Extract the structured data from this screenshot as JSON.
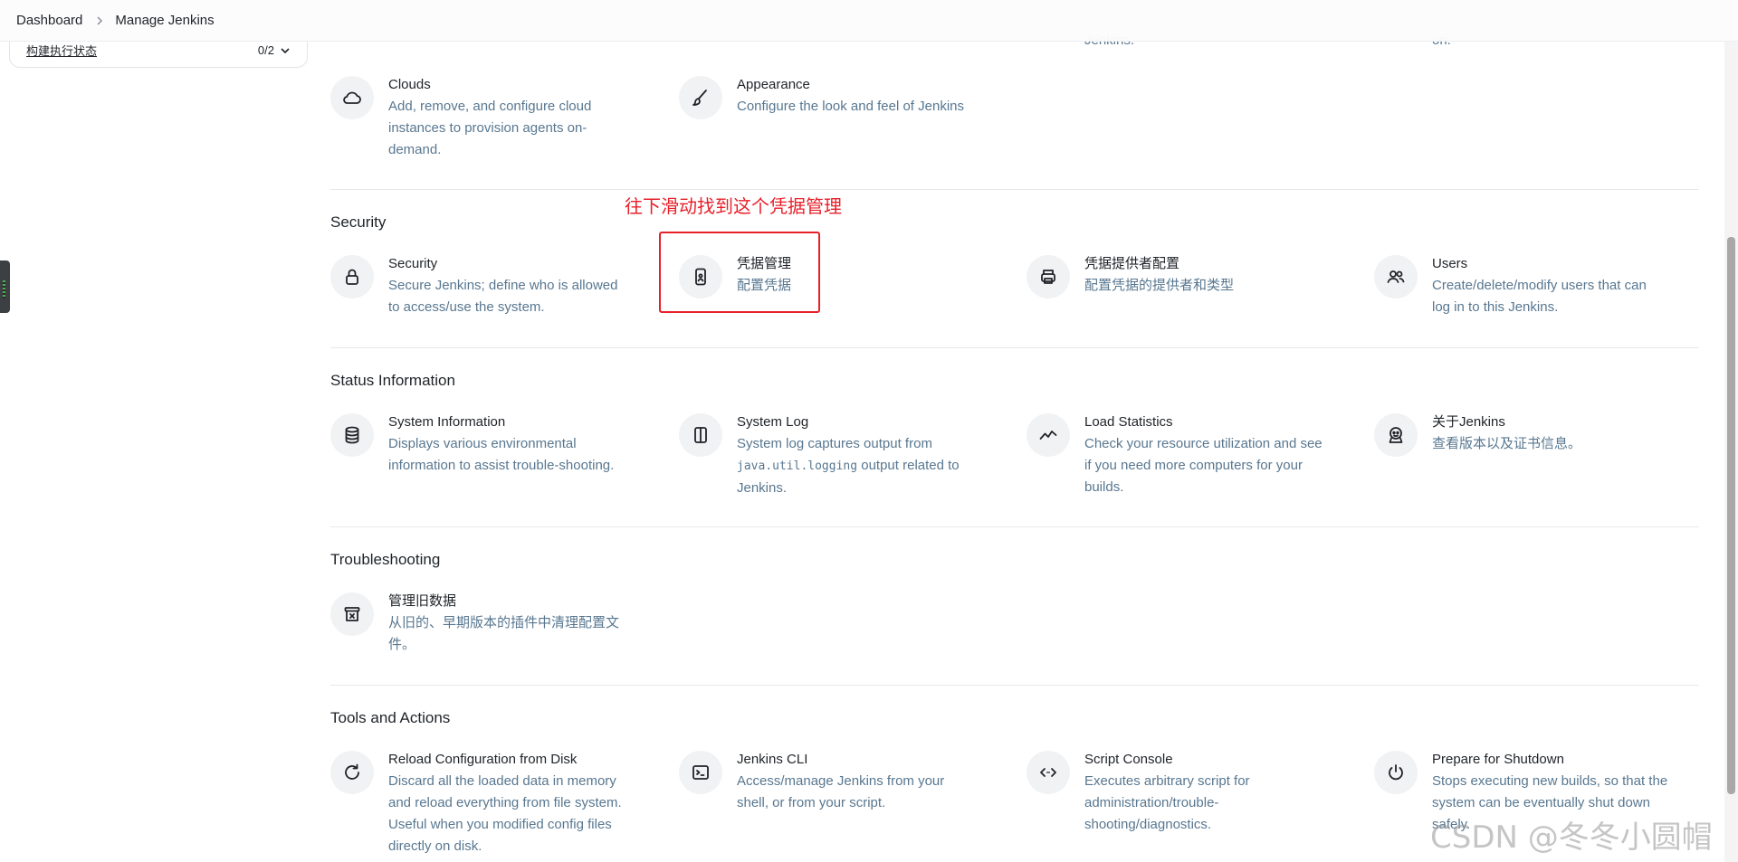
{
  "breadcrumb": {
    "items": [
      "Dashboard",
      "Manage Jenkins"
    ]
  },
  "sidebar": {
    "executor_status": {
      "label": "构建执行状态",
      "count": "0/2"
    }
  },
  "fragments": {
    "col3": "Jenkins.",
    "col4": "on."
  },
  "annotation": {
    "text": "往下滑动找到这个凭据管理"
  },
  "sections": {
    "cloud": {
      "items": [
        {
          "title": "Clouds",
          "desc": [
            "Add, remove, and configure cloud",
            "instances to provision agents on-",
            "demand."
          ],
          "icon": "cloud-icon"
        },
        {
          "title": "Appearance",
          "desc": [
            "Configure the look and feel of Jenkins"
          ],
          "icon": "brush-icon"
        }
      ]
    },
    "security": {
      "title": "Security",
      "items": [
        {
          "title": "Security",
          "desc": [
            "Secure Jenkins; define who is allowed",
            "to access/use the system."
          ],
          "icon": "lock-icon"
        },
        {
          "title": "凭据管理",
          "desc": [
            "配置凭据"
          ],
          "icon": "credentials-icon"
        },
        {
          "title": "凭据提供者配置",
          "desc": [
            "配置凭据的提供者和类型"
          ],
          "icon": "credential-provider-icon"
        },
        {
          "title": "Users",
          "desc": [
            "Create/delete/modify users that can",
            "log in to this Jenkins."
          ],
          "icon": "users-icon"
        }
      ]
    },
    "status": {
      "title": "Status Information",
      "items": [
        {
          "title": "System Information",
          "desc": [
            "Displays various environmental",
            "information to assist trouble-shooting."
          ],
          "icon": "database-icon"
        },
        {
          "title": "System Log",
          "desc_pre": "System log captures output from",
          "desc_code": "java.util.logging",
          "desc_post": " output related to",
          "desc_last": "Jenkins.",
          "icon": "log-icon"
        },
        {
          "title": "Load Statistics",
          "desc": [
            "Check your resource utilization and see",
            "if you need more computers for your",
            "builds."
          ],
          "icon": "activity-icon"
        },
        {
          "title": "关于Jenkins",
          "desc": [
            "查看版本以及证书信息。"
          ],
          "icon": "jenkins-icon"
        }
      ]
    },
    "troubleshooting": {
      "title": "Troubleshooting",
      "items": [
        {
          "title": "管理旧数据",
          "desc": [
            "从旧的、早期版本的插件中清理配置文",
            "件。"
          ],
          "icon": "archive-icon"
        }
      ]
    },
    "tools": {
      "title": "Tools and Actions",
      "items": [
        {
          "title": "Reload Configuration from Disk",
          "desc": [
            "Discard all the loaded data in memory",
            "and reload everything from file system.",
            "Useful when you modified config files",
            "directly on disk."
          ],
          "icon": "reload-icon"
        },
        {
          "title": "Jenkins CLI",
          "desc": [
            "Access/manage Jenkins from your",
            "shell, or from your script."
          ],
          "icon": "terminal-icon"
        },
        {
          "title": "Script Console",
          "desc": [
            "Executes arbitrary script for",
            "administration/trouble-",
            "shooting/diagnostics."
          ],
          "icon": "code-icon"
        },
        {
          "title": "Prepare for Shutdown",
          "desc": [
            "Stops executing new builds, so that the",
            "system can be eventually shut down",
            "safely."
          ],
          "icon": "power-icon"
        }
      ]
    }
  },
  "watermark": "CSDN @冬冬小圆帽"
}
